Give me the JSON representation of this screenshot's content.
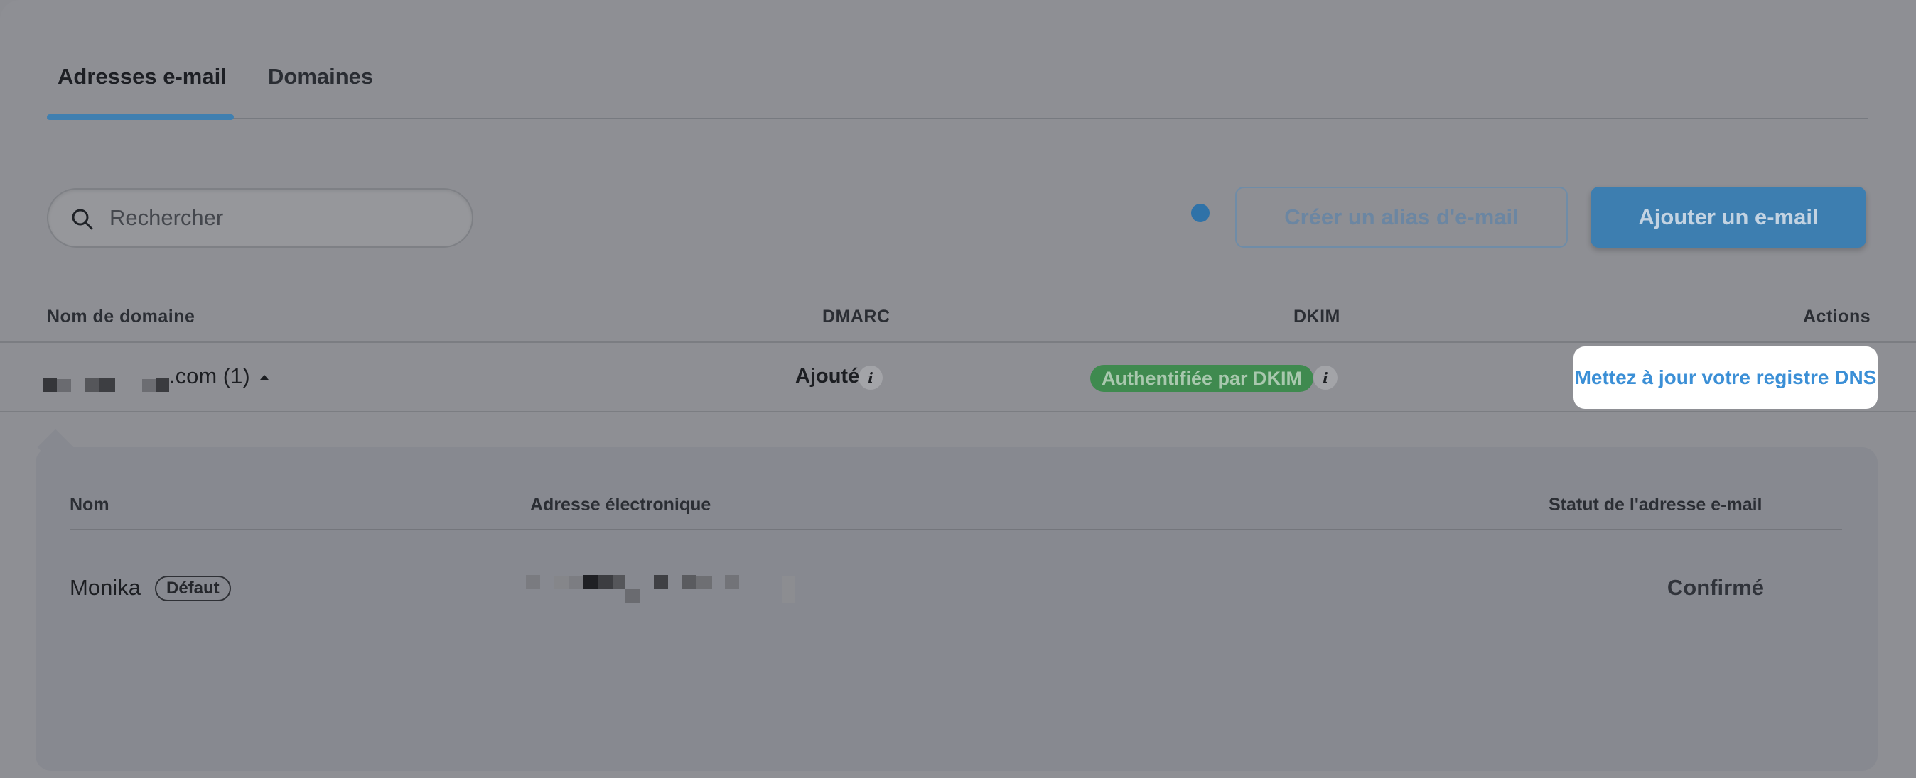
{
  "tabs": [
    {
      "label": "Adresses e-mail",
      "active": true
    },
    {
      "label": "Domaines",
      "active": false
    }
  ],
  "search": {
    "placeholder": "Rechercher",
    "icon": "search-icon"
  },
  "toolbar": {
    "create_alias_label": "Créer un alias d'e-mail",
    "add_email_label": "Ajouter un e-mail"
  },
  "domain_table": {
    "headers": {
      "domain": "Nom de domaine",
      "dmarc": "DMARC",
      "dkim": "DKIM",
      "actions": "Actions"
    },
    "rows": [
      {
        "domain_suffix": ".com (1)",
        "dmarc": "Ajouté",
        "dkim": "Authentifiée par DKIM",
        "action": "Mettez à jour votre registre DNS"
      }
    ]
  },
  "email_table": {
    "headers": {
      "name": "Nom",
      "address": "Adresse électronique",
      "status": "Statut de l'adresse e-mail"
    },
    "rows": [
      {
        "name": "Monika",
        "badge": "Défaut",
        "status": "Confirmé"
      }
    ]
  },
  "colors": {
    "accent": "#3d7eb0",
    "link": "#3b8fd6",
    "success_badge": "#3f8a4f"
  }
}
